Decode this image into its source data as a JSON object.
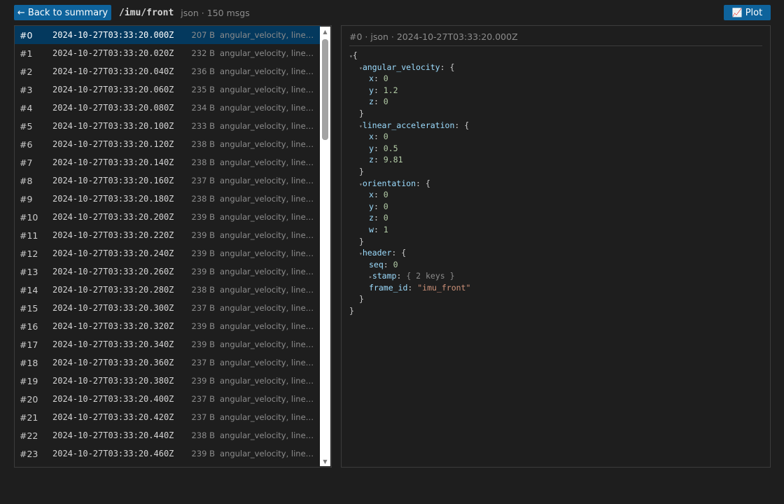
{
  "toolbar": {
    "back_label": "← Back to summary",
    "topic": "/imu/front",
    "topic_meta": "json · 150 msgs",
    "plot_icon": "📈",
    "plot_label": "Plot"
  },
  "messages": [
    {
      "idx": "#0",
      "ts": "2024-10-27T03:33:20.000Z",
      "size": "207 B",
      "fields": "angular_velocity, linear_acceleration, orientation, header"
    },
    {
      "idx": "#1",
      "ts": "2024-10-27T03:33:20.020Z",
      "size": "232 B",
      "fields": "angular_velocity, linear_acceleration, orientation, header"
    },
    {
      "idx": "#2",
      "ts": "2024-10-27T03:33:20.040Z",
      "size": "236 B",
      "fields": "angular_velocity, linear_acceleration, orientation, header"
    },
    {
      "idx": "#3",
      "ts": "2024-10-27T03:33:20.060Z",
      "size": "235 B",
      "fields": "angular_velocity, linear_acceleration, orientation, header"
    },
    {
      "idx": "#4",
      "ts": "2024-10-27T03:33:20.080Z",
      "size": "234 B",
      "fields": "angular_velocity, linear_acceleration, orientation, header"
    },
    {
      "idx": "#5",
      "ts": "2024-10-27T03:33:20.100Z",
      "size": "233 B",
      "fields": "angular_velocity, linear_acceleration, orientation, header"
    },
    {
      "idx": "#6",
      "ts": "2024-10-27T03:33:20.120Z",
      "size": "238 B",
      "fields": "angular_velocity, linear_acceleration, orientation, header"
    },
    {
      "idx": "#7",
      "ts": "2024-10-27T03:33:20.140Z",
      "size": "238 B",
      "fields": "angular_velocity, linear_acceleration, orientation, header"
    },
    {
      "idx": "#8",
      "ts": "2024-10-27T03:33:20.160Z",
      "size": "237 B",
      "fields": "angular_velocity, linear_acceleration, orientation, header"
    },
    {
      "idx": "#9",
      "ts": "2024-10-27T03:33:20.180Z",
      "size": "238 B",
      "fields": "angular_velocity, linear_acceleration, orientation, header"
    },
    {
      "idx": "#10",
      "ts": "2024-10-27T03:33:20.200Z",
      "size": "239 B",
      "fields": "angular_velocity, linear_acceleration, orientation, header"
    },
    {
      "idx": "#11",
      "ts": "2024-10-27T03:33:20.220Z",
      "size": "239 B",
      "fields": "angular_velocity, linear_acceleration, orientation, header"
    },
    {
      "idx": "#12",
      "ts": "2024-10-27T03:33:20.240Z",
      "size": "239 B",
      "fields": "angular_velocity, linear_acceleration, orientation, header"
    },
    {
      "idx": "#13",
      "ts": "2024-10-27T03:33:20.260Z",
      "size": "239 B",
      "fields": "angular_velocity, linear_acceleration, orientation, header"
    },
    {
      "idx": "#14",
      "ts": "2024-10-27T03:33:20.280Z",
      "size": "238 B",
      "fields": "angular_velocity, linear_acceleration, orientation, header"
    },
    {
      "idx": "#15",
      "ts": "2024-10-27T03:33:20.300Z",
      "size": "237 B",
      "fields": "angular_velocity, linear_acceleration, orientation, header"
    },
    {
      "idx": "#16",
      "ts": "2024-10-27T03:33:20.320Z",
      "size": "239 B",
      "fields": "angular_velocity, linear_acceleration, orientation, header"
    },
    {
      "idx": "#17",
      "ts": "2024-10-27T03:33:20.340Z",
      "size": "239 B",
      "fields": "angular_velocity, linear_acceleration, orientation, header"
    },
    {
      "idx": "#18",
      "ts": "2024-10-27T03:33:20.360Z",
      "size": "237 B",
      "fields": "angular_velocity, linear_acceleration, orientation, header"
    },
    {
      "idx": "#19",
      "ts": "2024-10-27T03:33:20.380Z",
      "size": "239 B",
      "fields": "angular_velocity, linear_acceleration, orientation, header"
    },
    {
      "idx": "#20",
      "ts": "2024-10-27T03:33:20.400Z",
      "size": "237 B",
      "fields": "angular_velocity, linear_acceleration, orientation, header"
    },
    {
      "idx": "#21",
      "ts": "2024-10-27T03:33:20.420Z",
      "size": "237 B",
      "fields": "angular_velocity, linear_acceleration, orientation, header"
    },
    {
      "idx": "#22",
      "ts": "2024-10-27T03:33:20.440Z",
      "size": "238 B",
      "fields": "angular_velocity, linear_acceleration, orientation, header"
    },
    {
      "idx": "#23",
      "ts": "2024-10-27T03:33:20.460Z",
      "size": "239 B",
      "fields": "angular_velocity, linear_acceleration, orientation, header"
    }
  ],
  "detail": {
    "header": "#0 · json · 2024-10-27T03:33:20.000Z",
    "json": {
      "angular_velocity": {
        "key": "angular_velocity",
        "x": "0",
        "y": "1.2",
        "z": "0"
      },
      "linear_acceleration": {
        "key": "linear_acceleration",
        "x": "0",
        "y": "0.5",
        "z": "9.81"
      },
      "orientation": {
        "key": "orientation",
        "x": "0",
        "y": "0",
        "z": "0",
        "w": "1"
      },
      "header": {
        "key": "header",
        "seq": "0",
        "stamp_key": "stamp",
        "stamp_summary": "{ 2 keys }",
        "frame_id": "\"imu_front\""
      }
    }
  }
}
